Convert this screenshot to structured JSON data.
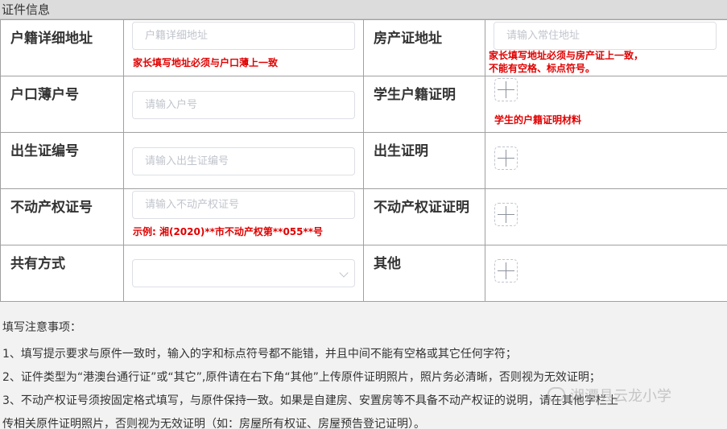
{
  "section": {
    "title": "证件信息"
  },
  "rows": [
    {
      "left_label": "户籍详细地址",
      "left_placeholder": "户籍详细地址",
      "left_hint": "家长填写地址必须与户口薄上一致",
      "right_label": "房产证地址",
      "right_placeholder": "请输入常住地址",
      "right_hint_line1": "家长填写地址必须与房产证上一致，",
      "right_hint_line2": "不能有空格、标点符号。"
    },
    {
      "left_label": "户口薄户号",
      "left_placeholder": "请输入户号",
      "right_label": "学生户籍证明",
      "right_hint": "学生的户籍证明材料"
    },
    {
      "left_label": "出生证编号",
      "left_placeholder": "请输入出生证编号",
      "right_label": "出生证明"
    },
    {
      "left_label": "不动产权证号",
      "left_placeholder": "请输入不动产权证号",
      "left_hint": "示例: 湘(2020)**市不动产权第**055**号",
      "right_label": "不动产权证证明"
    },
    {
      "left_label": "共有方式",
      "left_select_value": "",
      "right_label": "其他"
    }
  ],
  "notes": {
    "title": "填写注意事项：",
    "items": [
      "1、填写提示要求与原件一致时，输入的字和标点符号都不能错，并且中间不能有空格或其它任何字符；",
      "2、证件类型为“港澳台通行证”或“其它”,原件请在右下角“其他”上传原件证明照片，照片务必清晰，否则视为无效证明；",
      "3、不动产权证号须按固定格式填写，与原件保持一致。如果是自建房、安置房等不具备不动产权证的说明，请在其他字栏上",
      "传相关原件证明照片，否则视为无效证明（如：房屋所有权证、房屋预告登记证明）。"
    ]
  },
  "watermark": {
    "text": "湘潭县云龙小学"
  },
  "colors": {
    "hint": "#e00000",
    "header_bg": "#dcdcdc",
    "border": "#a0a0a0"
  }
}
